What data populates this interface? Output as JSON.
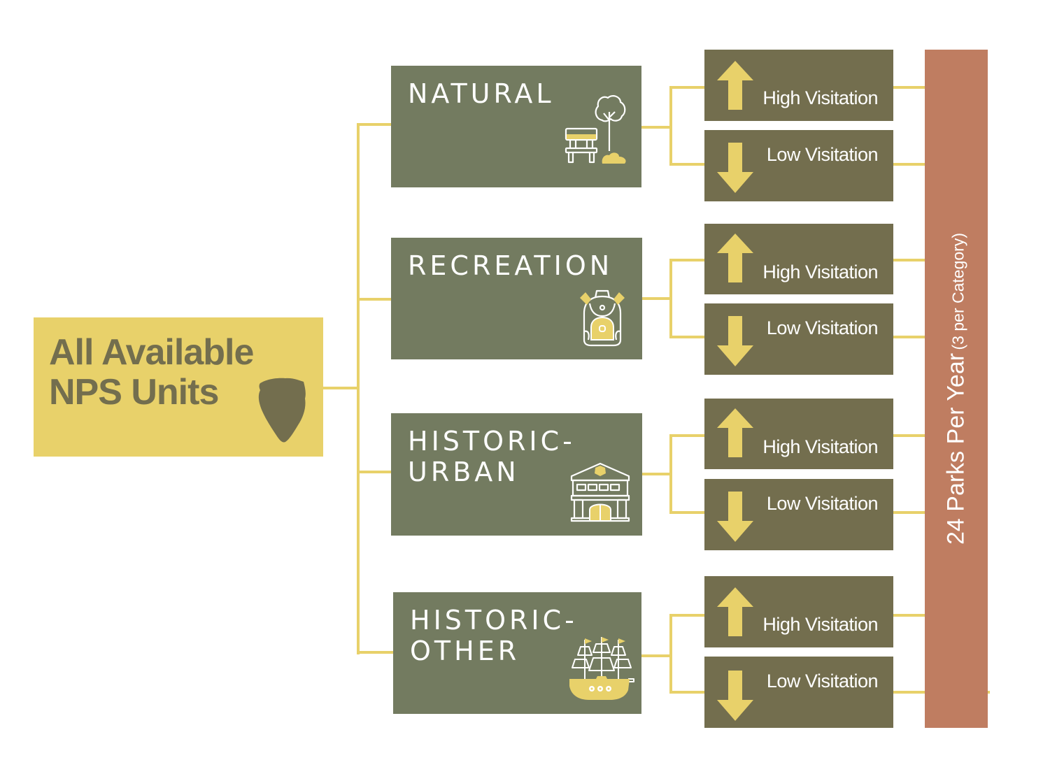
{
  "colors": {
    "root_fill": "#e8d16a",
    "root_text": "#736e4e",
    "category_fill": "#737b60",
    "visitation_fill": "#736e4e",
    "summary_fill": "#bf7d61",
    "connector": "#e8d16a",
    "accent": "#e8d16a"
  },
  "root": {
    "title_line1": "All Available",
    "title_line2": "NPS Units",
    "icon": "nps-arrowhead-icon"
  },
  "categories": [
    {
      "label": "NATURAL",
      "icon": "park-bench-tree-icon",
      "high_label": "High Visitation",
      "low_label": "Low Visitation"
    },
    {
      "label": "RECREATION",
      "icon": "backpack-icon",
      "high_label": "High Visitation",
      "low_label": "Low Visitation"
    },
    {
      "label": "HISTORIC-\nURBAN",
      "icon": "historic-building-icon",
      "high_label": "High Visitation",
      "low_label": "Low Visitation"
    },
    {
      "label": "HISTORIC-\nOTHER",
      "icon": "sailing-ship-icon",
      "high_label": "High Visitation",
      "low_label": "Low Visitation"
    }
  ],
  "summary": {
    "main": "24 Parks Per Year",
    "sub": "(3 per Category)"
  }
}
